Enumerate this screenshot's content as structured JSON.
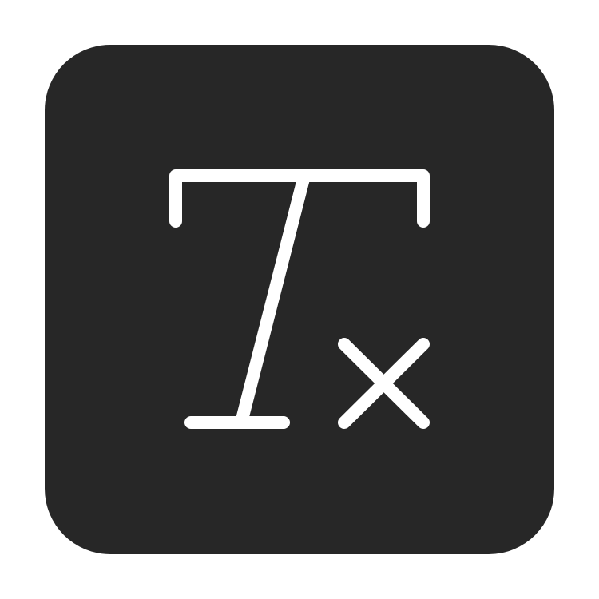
{
  "icon": {
    "name": "clear-formatting-icon",
    "background_color": "#272727",
    "glyph_color": "#ffffff",
    "page_background": "#ffffff"
  }
}
